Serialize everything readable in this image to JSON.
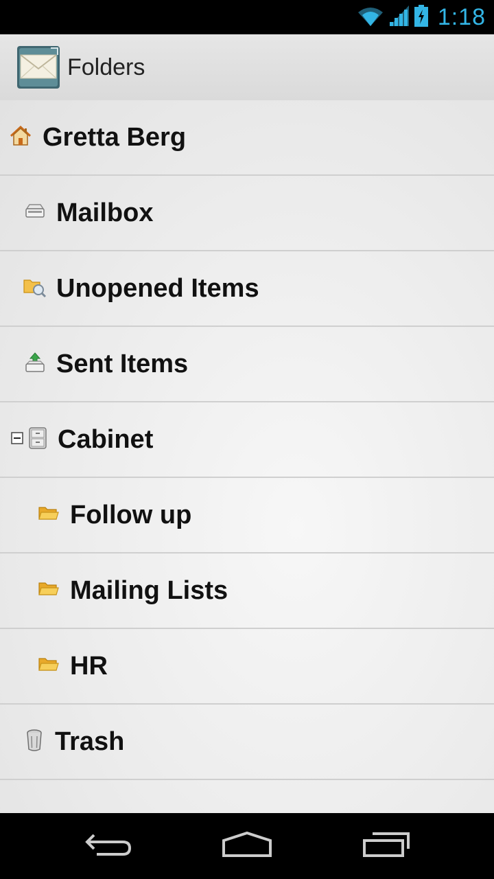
{
  "status_bar": {
    "time": "1:18"
  },
  "action_bar": {
    "title": "Folders"
  },
  "folders": [
    {
      "label": "Gretta Berg",
      "icon": "home-icon"
    },
    {
      "label": "Mailbox",
      "icon": "mailbox-tray-icon"
    },
    {
      "label": "Unopened Items",
      "icon": "folder-search-icon"
    },
    {
      "label": "Sent Items",
      "icon": "sent-tray-icon"
    },
    {
      "label": "Cabinet",
      "icon": "cabinet-icon",
      "collapse_toggle": "collapse-minus-icon"
    },
    {
      "label": "Follow up",
      "icon": "folder-open-icon"
    },
    {
      "label": "Mailing Lists",
      "icon": "folder-open-icon"
    },
    {
      "label": "HR",
      "icon": "folder-open-icon"
    },
    {
      "label": "Trash",
      "icon": "trash-can-icon"
    }
  ],
  "colors": {
    "status_accent": "#33b5e5",
    "folder_yellow": "#f3c04a",
    "home_orange": "#c86a1a"
  }
}
